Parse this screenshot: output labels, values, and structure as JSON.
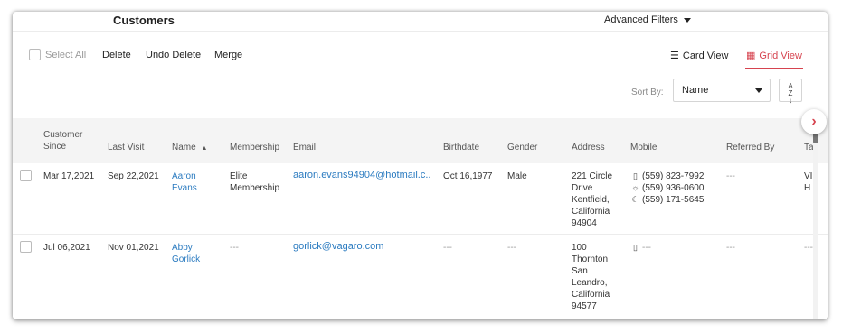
{
  "header": {
    "title": "Customers",
    "advanced_filters": "Advanced Filters"
  },
  "toolbar": {
    "select_all": "Select All",
    "delete": "Delete",
    "undo_delete": "Undo Delete",
    "merge": "Merge",
    "card_view": "Card View",
    "grid_view": "Grid View",
    "active_view": "Grid View"
  },
  "sort": {
    "label": "Sort By:",
    "value": "Name"
  },
  "columns": {
    "customer_since_line1": "Customer",
    "customer_since_line2": "Since",
    "last_visit": "Last Visit",
    "name": "Name",
    "membership": "Membership",
    "email": "Email",
    "birthdate": "Birthdate",
    "gender": "Gender",
    "address": "Address",
    "mobile": "Mobile",
    "referred_by": "Referred By",
    "tags_partial": "Ta"
  },
  "rows": [
    {
      "customer_since": "Mar 17,2021",
      "last_visit": "Sep 22,2021",
      "name_first": "Aaron",
      "name_last": "Evans",
      "membership_line1": "Elite",
      "membership_line2": "Membership",
      "email": "aaron.evans94904@hotmail.c..",
      "birthdate": "Oct 16,1977",
      "gender": "Male",
      "address": [
        "221 Circle",
        "Drive",
        "Kentfield,",
        "California",
        "94904"
      ],
      "mobile": {
        "cell": "(559) 823-7992",
        "day": "(559) 936-0600",
        "night": "(559) 171-5645"
      },
      "referred_by": "---",
      "tags_partial_1": "VI",
      "tags_partial_2": "H"
    },
    {
      "customer_since": "Jul 06,2021",
      "last_visit": "Nov 01,2021",
      "name_first": "Abby",
      "name_last": "Gorlick",
      "membership": "---",
      "email": "gorlick@vagaro.com",
      "birthdate": "---",
      "gender": "---",
      "address": [
        "100",
        "Thornton",
        "San",
        "Leandro,",
        "California",
        "94577"
      ],
      "mobile": {
        "cell": "---"
      },
      "referred_by": "---",
      "tags_partial": "---"
    }
  ],
  "colors": {
    "accent": "#d6434f",
    "link": "#2b7bc0"
  },
  "icons": {
    "cell": "mobile-phone-icon",
    "day": "sun-icon",
    "night": "moon-icon",
    "next": "chevron-right-icon"
  }
}
